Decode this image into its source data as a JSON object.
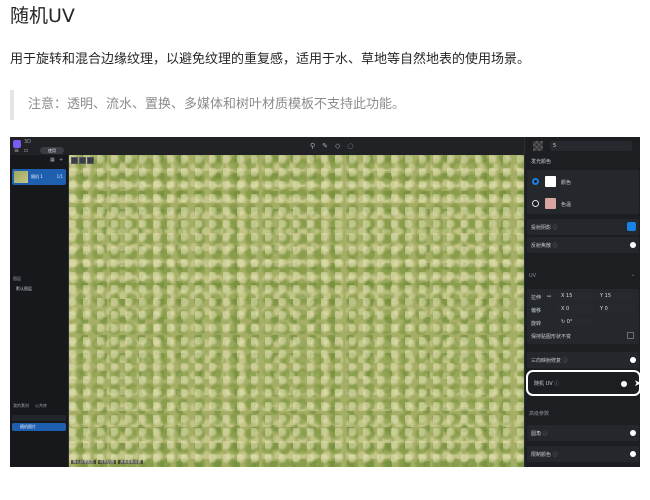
{
  "doc": {
    "title": "随机UV",
    "description": "用于旋转和混合边缘纹理，以避免纹理的重复感，适用于水、草地等自然地表的使用场景。",
    "note": "注意：透明、流水、置换、多媒体和树叶材质模板不支持此功能。"
  },
  "app": {
    "name": "3D",
    "save_label": "使用",
    "texture_item": {
      "label": "随机 1",
      "count": "1/1"
    },
    "layer_header": "图层",
    "layer_item": "默认图层",
    "library_tabs": [
      "我的素材",
      "公共库"
    ],
    "library_item": "随机图片",
    "viewport_status": [
      "默认纹理图层",
      "材质贴图",
      "其他参数设置"
    ]
  },
  "panel": {
    "number_value": "5",
    "emission_color_label": "发光颜色",
    "color_option": "颜色",
    "temperature_option": "色温",
    "color_value": "#ffffff",
    "temperature_value": "#d9a39e",
    "accent_color": "#1a82e6",
    "cast_shadow_label": "投射阴影",
    "reflection_label": "反射焦散",
    "uv_section": "UV",
    "tile_label": "拉伸",
    "tile_x": "X 15",
    "tile_y": "Y 15",
    "offset_label": "偏移",
    "offset_x": "X 0",
    "offset_y": "Y 0",
    "rotation_label": "旋转",
    "rotation_value": "0°",
    "keep_ratio_label": "保持贴图形状不变",
    "triplanar_label": "三向映射修复",
    "random_uv_label": "随机 UV",
    "advanced_section": "高级参数",
    "rounded_label": "圆角",
    "limit_color_label": "限制颜色"
  }
}
